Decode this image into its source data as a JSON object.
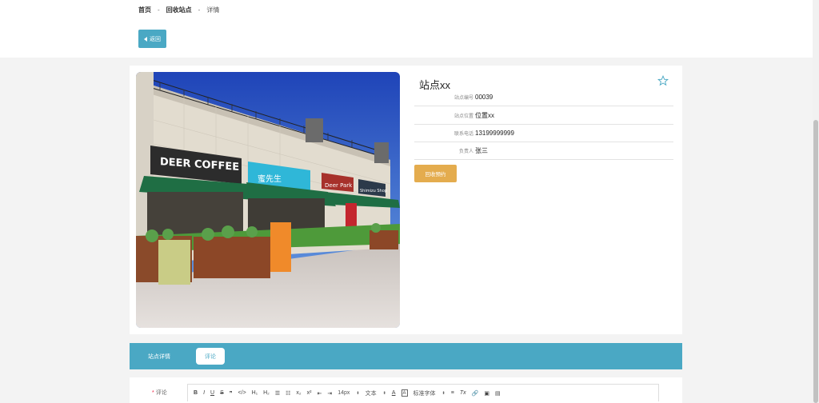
{
  "breadcrumb": {
    "home": "首页",
    "section": "回收站点",
    "current": "详情",
    "sep": "-"
  },
  "back_button": {
    "label": "返回"
  },
  "station": {
    "title": "站点xx",
    "fields": [
      {
        "label": "站点编号",
        "value": "00039"
      },
      {
        "label": "站点位置",
        "value": "位置xx"
      },
      {
        "label": "联系电话",
        "value": "13199999999"
      },
      {
        "label": "负责人",
        "value": "张三"
      }
    ],
    "book_button": "回收预约"
  },
  "photo": {
    "sign_main": "DEER COFFEE",
    "sign_blue": "蜜先生",
    "sign_red": "Deer Park",
    "sign_dark": "Shimizu Shop"
  },
  "tabs": [
    {
      "label": "站点详情"
    },
    {
      "label": "评论"
    }
  ],
  "editor": {
    "label": "评论",
    "required_mark": "*",
    "toolbar": {
      "bold": "B",
      "italic": "I",
      "underline": "U",
      "strike": "S",
      "quote": "❞",
      "code": "</>",
      "h1": "H₁",
      "h2": "H₂",
      "ol": "☰",
      "ul": "☷",
      "sub": "x₂",
      "sup": "x²",
      "outdent": "⇤",
      "indent": "⇥",
      "size": "14px",
      "header": "文本",
      "color": "A",
      "bg": "A",
      "font": "标准字体",
      "align": "≡",
      "clean": "Tx",
      "link": "🔗",
      "image": "▣",
      "video": "▤",
      "select_arrow": "⬍"
    }
  },
  "colors": {
    "accent": "#4aa8c4",
    "warning": "#e4ac4e"
  }
}
